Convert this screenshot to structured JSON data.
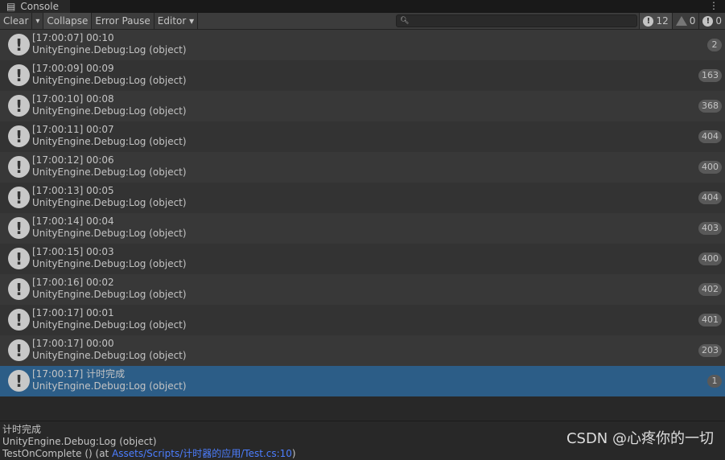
{
  "window": {
    "tab_title": "Console",
    "tab_icon": "console-icon",
    "menu_icon": "more-vertical-icon"
  },
  "toolbar": {
    "clear": "Clear",
    "clear_dropdown": "▾",
    "collapse": "Collapse",
    "collapse_active": true,
    "error_pause": "Error Pause",
    "editor": "Editor ▾",
    "search_placeholder": "",
    "log_count": "12",
    "warning_count": "0",
    "error_count": "0"
  },
  "entries": [
    {
      "line1": "[17:00:07] 00:10",
      "line2": "UnityEngine.Debug:Log (object)",
      "count": "2"
    },
    {
      "line1": "[17:00:09] 00:09",
      "line2": "UnityEngine.Debug:Log (object)",
      "count": "163"
    },
    {
      "line1": "[17:00:10] 00:08",
      "line2": "UnityEngine.Debug:Log (object)",
      "count": "368"
    },
    {
      "line1": "[17:00:11] 00:07",
      "line2": "UnityEngine.Debug:Log (object)",
      "count": "404"
    },
    {
      "line1": "[17:00:12] 00:06",
      "line2": "UnityEngine.Debug:Log (object)",
      "count": "400"
    },
    {
      "line1": "[17:00:13] 00:05",
      "line2": "UnityEngine.Debug:Log (object)",
      "count": "404"
    },
    {
      "line1": "[17:00:14] 00:04",
      "line2": "UnityEngine.Debug:Log (object)",
      "count": "403"
    },
    {
      "line1": "[17:00:15] 00:03",
      "line2": "UnityEngine.Debug:Log (object)",
      "count": "400"
    },
    {
      "line1": "[17:00:16] 00:02",
      "line2": "UnityEngine.Debug:Log (object)",
      "count": "402"
    },
    {
      "line1": "[17:00:17] 00:01",
      "line2": "UnityEngine.Debug:Log (object)",
      "count": "401"
    },
    {
      "line1": "[17:00:17] 00:00",
      "line2": "UnityEngine.Debug:Log (object)",
      "count": "203"
    },
    {
      "line1": "[17:00:17] 计时完成",
      "line2": "UnityEngine.Debug:Log (object)",
      "count": "1",
      "selected": true
    }
  ],
  "detail": {
    "line1": "计时完成",
    "line2": "UnityEngine.Debug:Log (object)",
    "line3_prefix": "TestOnComplete () (at ",
    "line3_link": "Assets/Scripts/计时器的应用/Test.cs:10",
    "line3_suffix": ")"
  },
  "watermark": "CSDN @心疼你的一切"
}
